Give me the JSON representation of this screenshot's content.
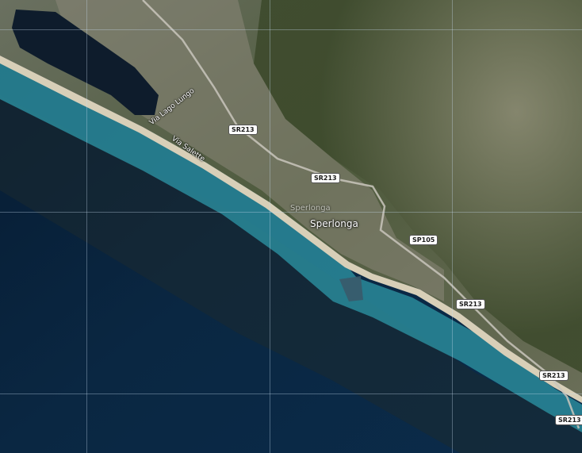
{
  "map": {
    "type": "satellite",
    "colors": {
      "deep_sea": "#0a2742",
      "shallow_sea": "#2a8a9a",
      "beach": "#d8cfb8",
      "land": "#4e5a3c",
      "lake": "#0e1c2c"
    }
  },
  "labels": {
    "place_ghost": "Sperlonga",
    "place_main": "Sperlonga",
    "street_1": "Via Lago Lungo",
    "street_2": "Via Salette"
  },
  "road_shields": [
    "SR213",
    "SR213",
    "SP105",
    "SR213",
    "SR213",
    "SR213"
  ]
}
